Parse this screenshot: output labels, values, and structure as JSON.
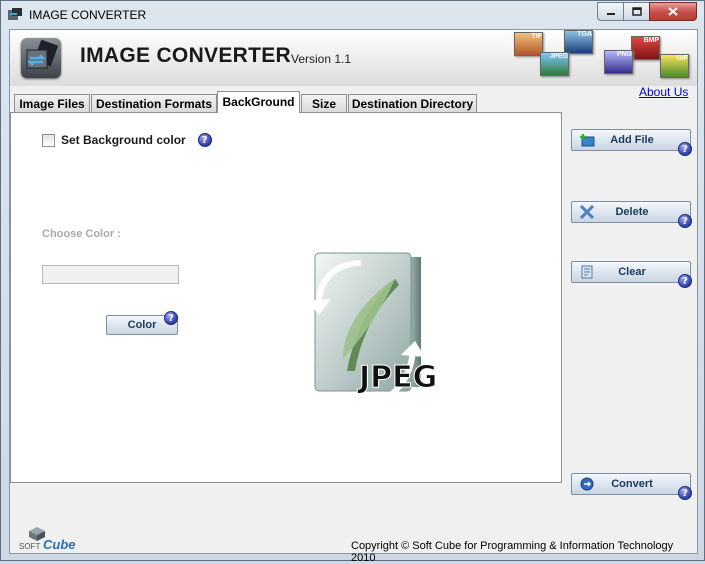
{
  "window": {
    "title": "IMAGE CONVERTER",
    "controls": {
      "minimize": "–",
      "maximize": "□",
      "close": "✕"
    }
  },
  "header": {
    "app_title": "IMAGE CONVERTER",
    "version": "Version 1.1",
    "about_link": "About Us",
    "format_tiles": [
      "TIF",
      "TGA",
      "BMP",
      "JPEG",
      "PNG",
      "GIF"
    ]
  },
  "tabs": [
    {
      "label": "Image Files",
      "active": false
    },
    {
      "label": "Destination Formats",
      "active": false
    },
    {
      "label": "BackGround",
      "active": true
    },
    {
      "label": "Size",
      "active": false
    },
    {
      "label": "Destination Directory",
      "active": false
    }
  ],
  "background_tab": {
    "set_bg_label": "Set Background color",
    "set_bg_checked": false,
    "choose_color_label": "Choose Color :",
    "color_value": "",
    "color_button": "Color",
    "art_text": "JPEG"
  },
  "side_buttons": {
    "add_file": "Add File",
    "delete": "Delete",
    "clear": "Clear",
    "convert": "Convert"
  },
  "help_glyph": "?",
  "footer": {
    "copyright": "Copyright © Soft Cube for Programming & Information Technology 2010",
    "logo_soft": "SOFT",
    "logo_cube": "Cube"
  },
  "colors": {
    "accent": "#1b3a5c",
    "help_blue": "#2d3ea8",
    "link": "#0000cc",
    "close_red": "#c75050"
  }
}
